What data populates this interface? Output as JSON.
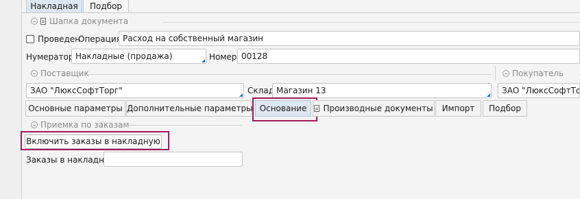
{
  "top_tabs": [
    "Накладная",
    "Подбор"
  ],
  "header_group": {
    "title": "Шапка документа"
  },
  "posted": {
    "label": "Проведен",
    "checked": false
  },
  "operation": {
    "label": "Операция",
    "value": "Расход на собственный магазин"
  },
  "numerator": {
    "label": "Нумератор",
    "value": "Накладные (продажа)"
  },
  "number": {
    "label": "Номер",
    "value": "00128"
  },
  "supplier": {
    "title": "Поставщик",
    "value": "ЗАО \"ЛюксСофтТорг\""
  },
  "warehouse": {
    "label": "Склад",
    "value": "Магазин 13"
  },
  "buyer": {
    "title": "Покупатель",
    "value": "ЗАО \"ЛюксСофтТорг\""
  },
  "sub_tabs": [
    "Основные параметры",
    "Дополнительные параметры",
    "Основание",
    "Производные документы",
    "Импорт",
    "Подбор"
  ],
  "orders_group": {
    "title": "Приемка по заказам"
  },
  "include_orders_button": "Включить заказы в накладную",
  "orders_in_invoice": {
    "label": "Заказы в накладной",
    "value": ""
  },
  "colors": {
    "highlight": "#a3195b",
    "accent": "#1f6fb2",
    "active_tab": "#dce7f1"
  }
}
